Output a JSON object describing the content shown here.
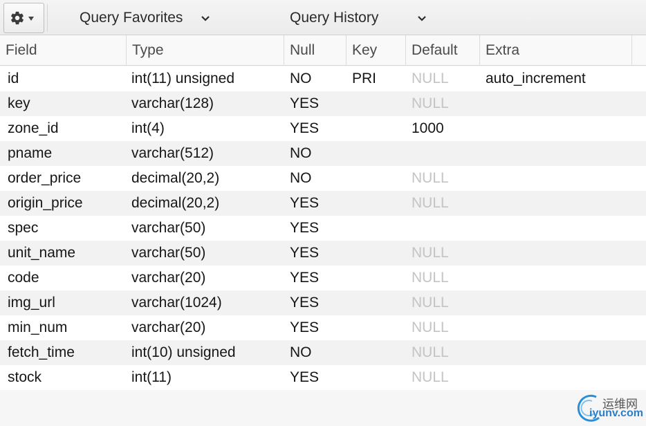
{
  "toolbar": {
    "query_favorites_label": "Query Favorites",
    "query_history_label": "Query History",
    "gear_icon": "gear-icon",
    "chevron_icon": "chevron-down-icon"
  },
  "table": {
    "columns": [
      "Field",
      "Type",
      "Null",
      "Key",
      "Default",
      "Extra"
    ],
    "rows": [
      {
        "field": "id",
        "type": "int(11) unsigned",
        "null": "NO",
        "key": "PRI",
        "default": "NULL",
        "extra": "auto_increment"
      },
      {
        "field": "key",
        "type": "varchar(128)",
        "null": "YES",
        "key": "",
        "default": "NULL",
        "extra": ""
      },
      {
        "field": "zone_id",
        "type": "int(4)",
        "null": "YES",
        "key": "",
        "default": "1000",
        "extra": ""
      },
      {
        "field": "pname",
        "type": "varchar(512)",
        "null": "NO",
        "key": "",
        "default": "",
        "extra": ""
      },
      {
        "field": "order_price",
        "type": "decimal(20,2)",
        "null": "NO",
        "key": "",
        "default": "NULL",
        "extra": ""
      },
      {
        "field": "origin_price",
        "type": "decimal(20,2)",
        "null": "YES",
        "key": "",
        "default": "NULL",
        "extra": ""
      },
      {
        "field": "spec",
        "type": "varchar(50)",
        "null": "YES",
        "key": "",
        "default": "",
        "extra": ""
      },
      {
        "field": "unit_name",
        "type": "varchar(50)",
        "null": "YES",
        "key": "",
        "default": "NULL",
        "extra": ""
      },
      {
        "field": "code",
        "type": "varchar(20)",
        "null": "YES",
        "key": "",
        "default": "NULL",
        "extra": ""
      },
      {
        "field": "img_url",
        "type": "varchar(1024)",
        "null": "YES",
        "key": "",
        "default": "NULL",
        "extra": ""
      },
      {
        "field": "min_num",
        "type": "varchar(20)",
        "null": "YES",
        "key": "",
        "default": "NULL",
        "extra": ""
      },
      {
        "field": "fetch_time",
        "type": "int(10) unsigned",
        "null": "NO",
        "key": "",
        "default": "NULL",
        "extra": ""
      },
      {
        "field": "stock",
        "type": "int(11)",
        "null": "YES",
        "key": "",
        "default": "NULL",
        "extra": ""
      }
    ]
  },
  "watermark": {
    "cn": "运维网",
    "en": "iyunv.com"
  },
  "colors": {
    "null_text": "#c4c4c4",
    "row_alt": "#f2f2f2",
    "header_text": "#4a4a4a"
  }
}
